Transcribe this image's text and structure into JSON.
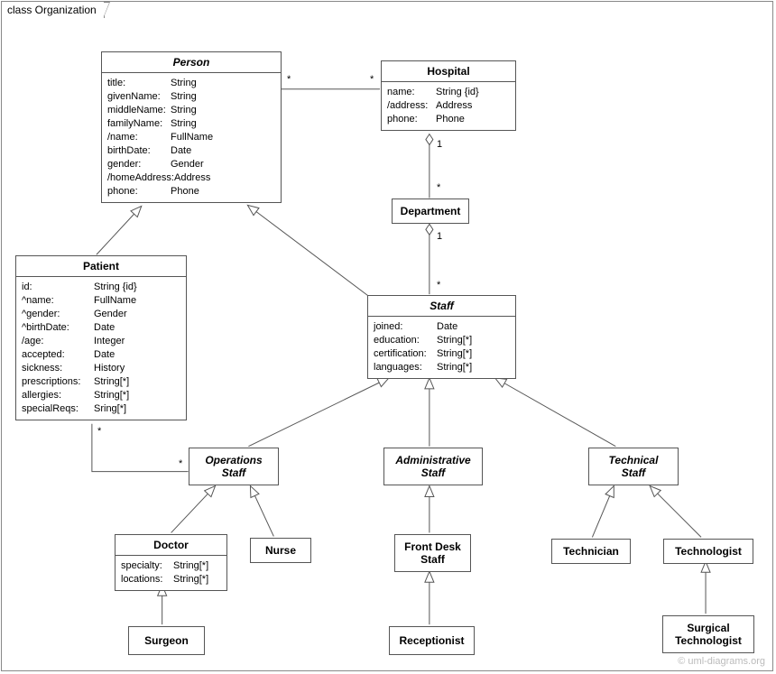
{
  "frame": {
    "label": "class Organization"
  },
  "watermark": "© uml-diagrams.org",
  "classes": {
    "person": {
      "name": "Person",
      "attrs": [
        {
          "n": "title:",
          "t": "String"
        },
        {
          "n": "givenName:",
          "t": "String"
        },
        {
          "n": "middleName:",
          "t": "String"
        },
        {
          "n": "familyName:",
          "t": "String"
        },
        {
          "n": "/name:",
          "t": "FullName"
        },
        {
          "n": "birthDate:",
          "t": "Date"
        },
        {
          "n": "gender:",
          "t": "Gender"
        },
        {
          "n": "/homeAddress:",
          "t": "Address"
        },
        {
          "n": "phone:",
          "t": "Phone"
        }
      ]
    },
    "hospital": {
      "name": "Hospital",
      "attrs": [
        {
          "n": "name:",
          "t": "String {id}"
        },
        {
          "n": "/address:",
          "t": "Address"
        },
        {
          "n": "phone:",
          "t": "Phone"
        }
      ]
    },
    "department": {
      "name": "Department"
    },
    "patient": {
      "name": "Patient",
      "attrs": [
        {
          "n": "id:",
          "t": "String {id}"
        },
        {
          "n": "^name:",
          "t": "FullName"
        },
        {
          "n": "^gender:",
          "t": "Gender"
        },
        {
          "n": "^birthDate:",
          "t": "Date"
        },
        {
          "n": "/age:",
          "t": "Integer"
        },
        {
          "n": "accepted:",
          "t": "Date"
        },
        {
          "n": "sickness:",
          "t": "History"
        },
        {
          "n": "prescriptions:",
          "t": "String[*]"
        },
        {
          "n": "allergies:",
          "t": "String[*]"
        },
        {
          "n": "specialReqs:",
          "t": "Sring[*]"
        }
      ]
    },
    "staff": {
      "name": "Staff",
      "attrs": [
        {
          "n": "joined:",
          "t": "Date"
        },
        {
          "n": "education:",
          "t": "String[*]"
        },
        {
          "n": "certification:",
          "t": "String[*]"
        },
        {
          "n": "languages:",
          "t": "String[*]"
        }
      ]
    },
    "operationsStaff": {
      "name": "Operations",
      "name2": "Staff"
    },
    "administrativeStaff": {
      "name": "Administrative",
      "name2": "Staff"
    },
    "technicalStaff": {
      "name": "Technical",
      "name2": "Staff"
    },
    "doctor": {
      "name": "Doctor",
      "attrs": [
        {
          "n": "specialty:",
          "t": "String[*]"
        },
        {
          "n": "locations:",
          "t": "String[*]"
        }
      ]
    },
    "nurse": {
      "name": "Nurse"
    },
    "frontDeskStaff": {
      "name": "Front Desk",
      "name2": "Staff"
    },
    "receptionist": {
      "name": "Receptionist"
    },
    "technician": {
      "name": "Technician"
    },
    "technologist": {
      "name": "Technologist"
    },
    "surgicalTechnologist": {
      "name": "Surgical",
      "name2": "Technologist"
    },
    "surgeon": {
      "name": "Surgeon"
    }
  },
  "multiplicities": {
    "personHospitalL": "*",
    "personHospitalR": "*",
    "hospitalDeptTop": "1",
    "hospitalDeptBot": "*",
    "deptStaffTop": "1",
    "deptStaffBot": "*",
    "patientOpsL": "*",
    "patientOpsR": "*"
  }
}
